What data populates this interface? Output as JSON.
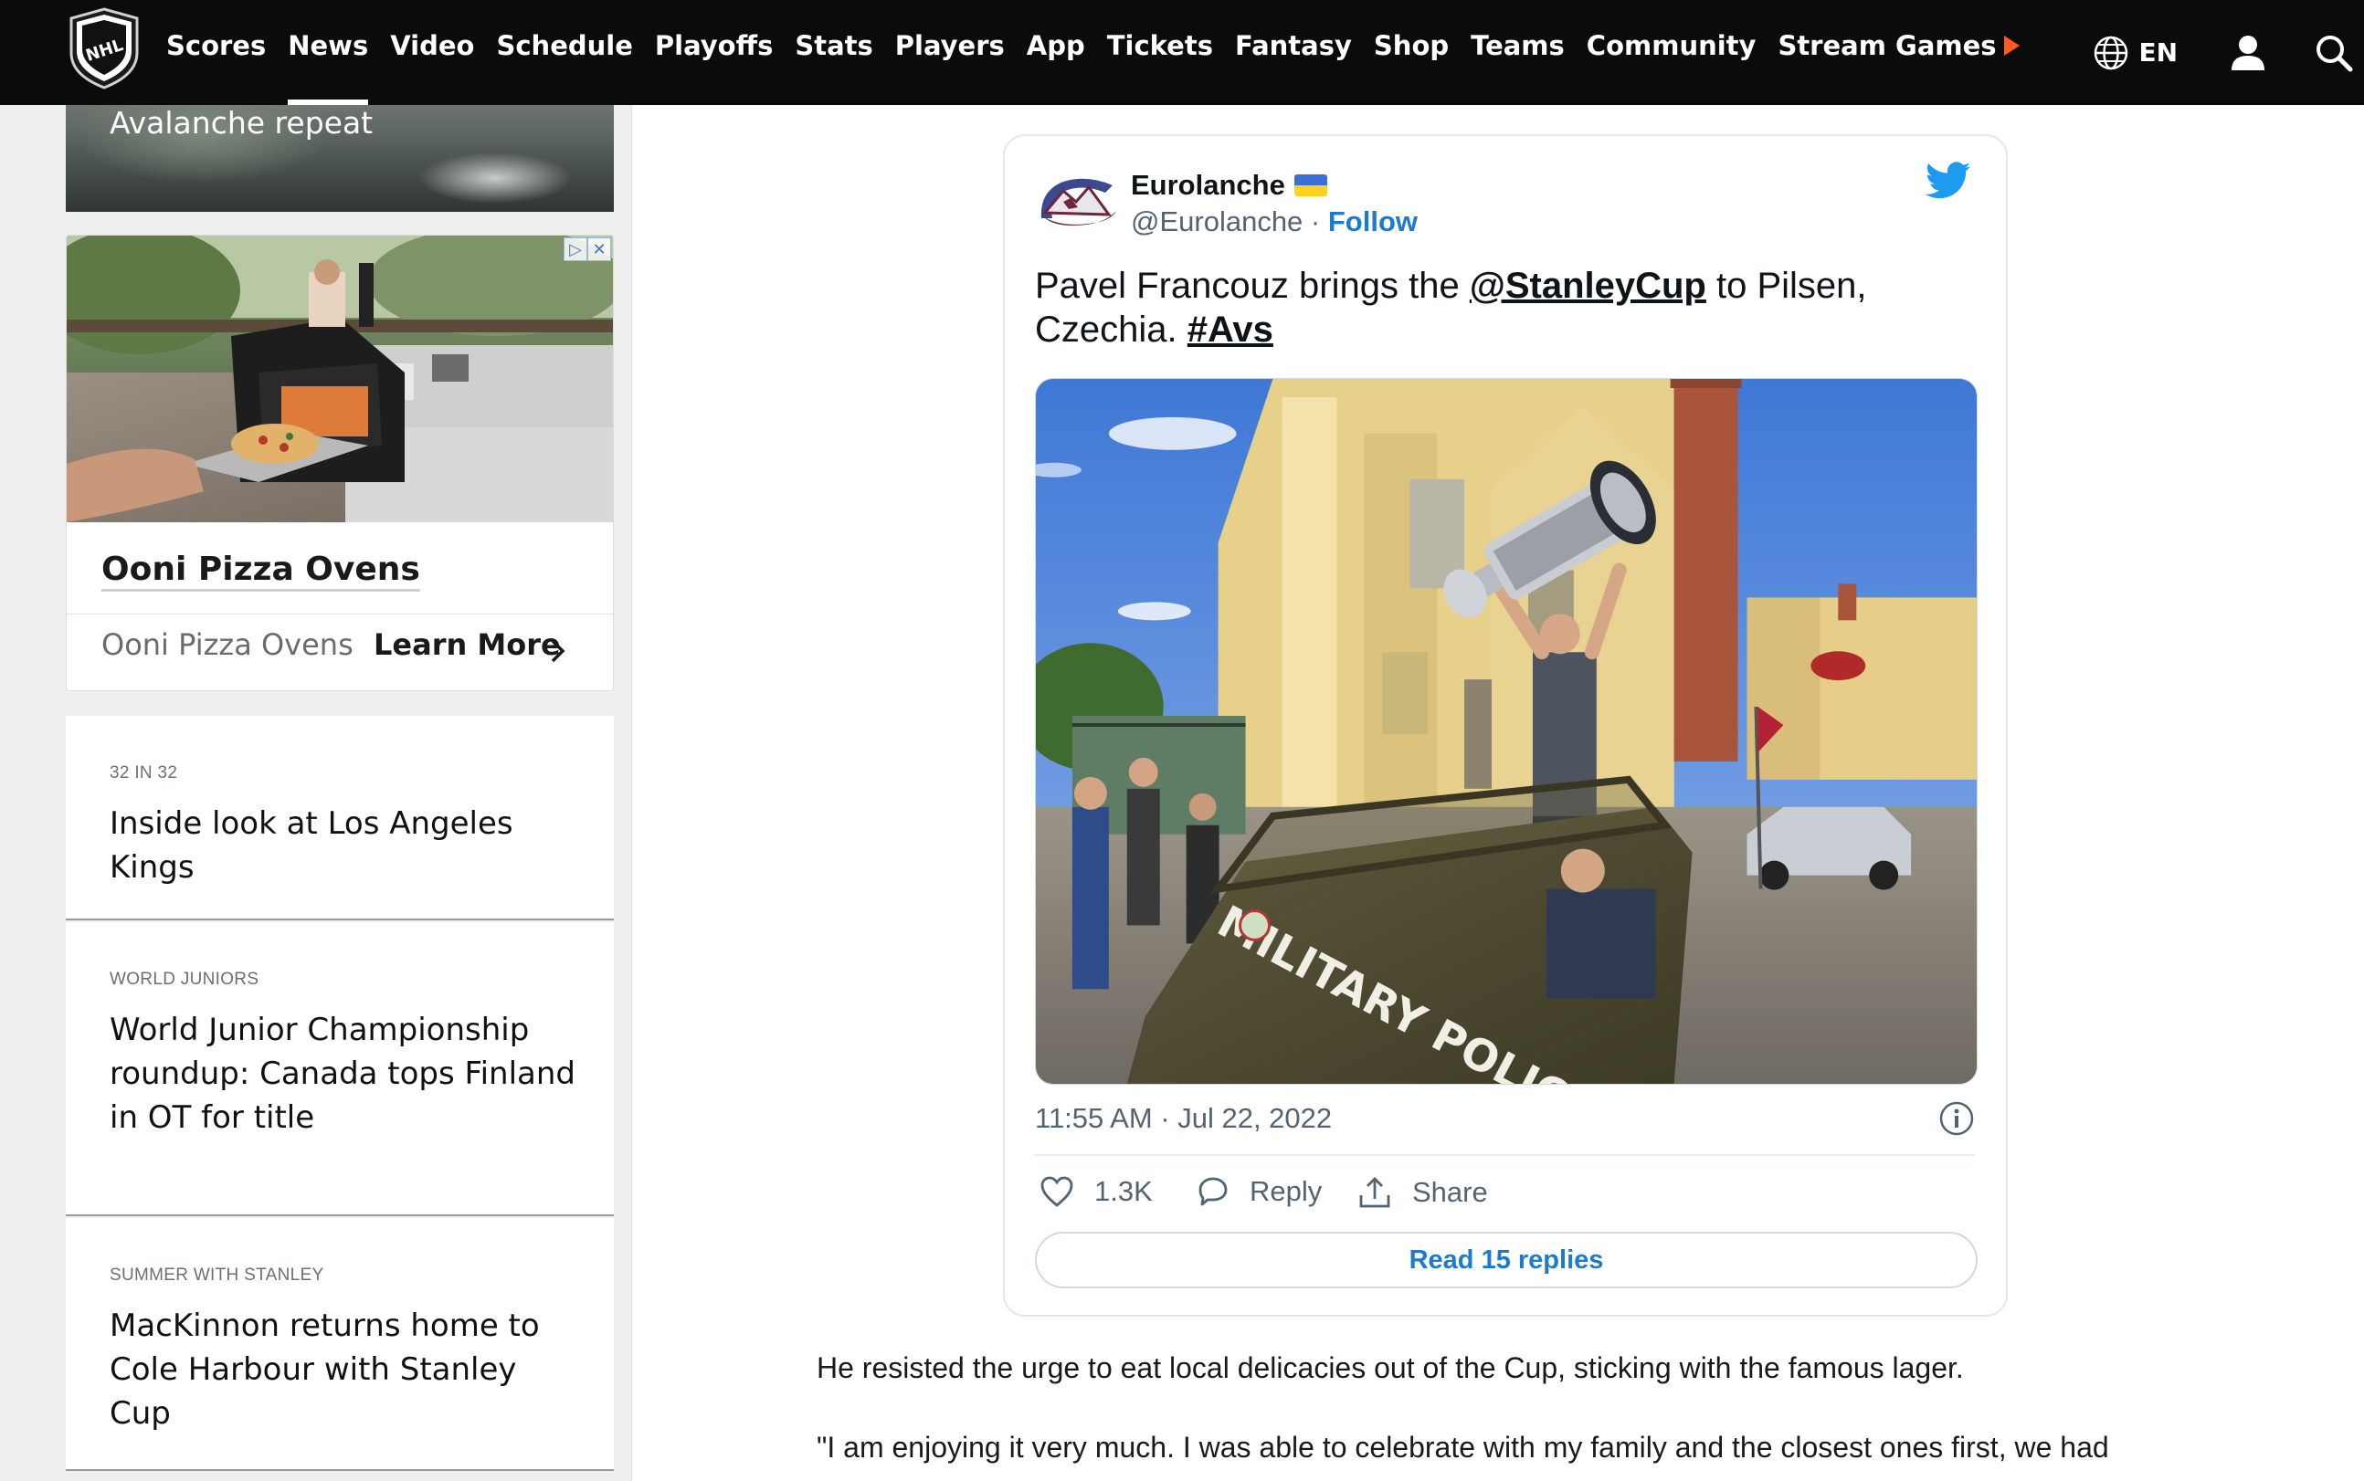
{
  "nav": {
    "items": [
      {
        "label": "Scores"
      },
      {
        "label": "News"
      },
      {
        "label": "Video"
      },
      {
        "label": "Schedule"
      },
      {
        "label": "Playoffs"
      },
      {
        "label": "Stats"
      },
      {
        "label": "Players"
      },
      {
        "label": "App"
      },
      {
        "label": "Tickets"
      },
      {
        "label": "Fantasy"
      },
      {
        "label": "Shop"
      },
      {
        "label": "Teams"
      },
      {
        "label": "Community"
      },
      {
        "label": "Stream Games"
      }
    ],
    "active": "News",
    "language": "EN"
  },
  "sidebar": {
    "top_story_title": "Avalanche repeat",
    "ad": {
      "title": "Ooni Pizza Ovens",
      "brand": "Ooni Pizza Ovens",
      "cta": "Learn More"
    },
    "stories": [
      {
        "tag": "32 IN 32",
        "title": "Inside look at Los Angeles Kings"
      },
      {
        "tag": "WORLD JUNIORS",
        "title": "World Junior Championship roundup: Canada tops Finland in OT for title"
      },
      {
        "tag": "SUMMER WITH STANLEY",
        "title": "MacKinnon returns home to Cole Harbour with Stanley Cup"
      }
    ]
  },
  "tweet": {
    "name": "Eurolanche",
    "handle": "@Eurolanche",
    "separator": " · ",
    "follow": "Follow",
    "text_1": "Pavel Francouz brings the ",
    "mention": "@StanleyCup",
    "text_2": " to Pilsen, Czechia. ",
    "hashtag": "#Avs",
    "photo_sign": "MILITARY POLICE",
    "timestamp": "11:55 AM · Jul 22, 2022",
    "likes": "1.3K",
    "reply_label": "Reply",
    "share_label": "Share",
    "read_replies": "Read 15 replies"
  },
  "article": {
    "paragraph_1": "He resisted the urge to eat local delicacies out of the Cup, sticking with the famous lager.",
    "paragraph_2": "\"I am enjoying it very much. I was able to celebrate with my family and the closest ones first, we had"
  },
  "colors": {
    "nav_bg": "#0b0b0b",
    "accent_orange": "#ff5a1f",
    "twitter_blue": "#1d9bf0",
    "link_blue": "#1d7bcf"
  }
}
